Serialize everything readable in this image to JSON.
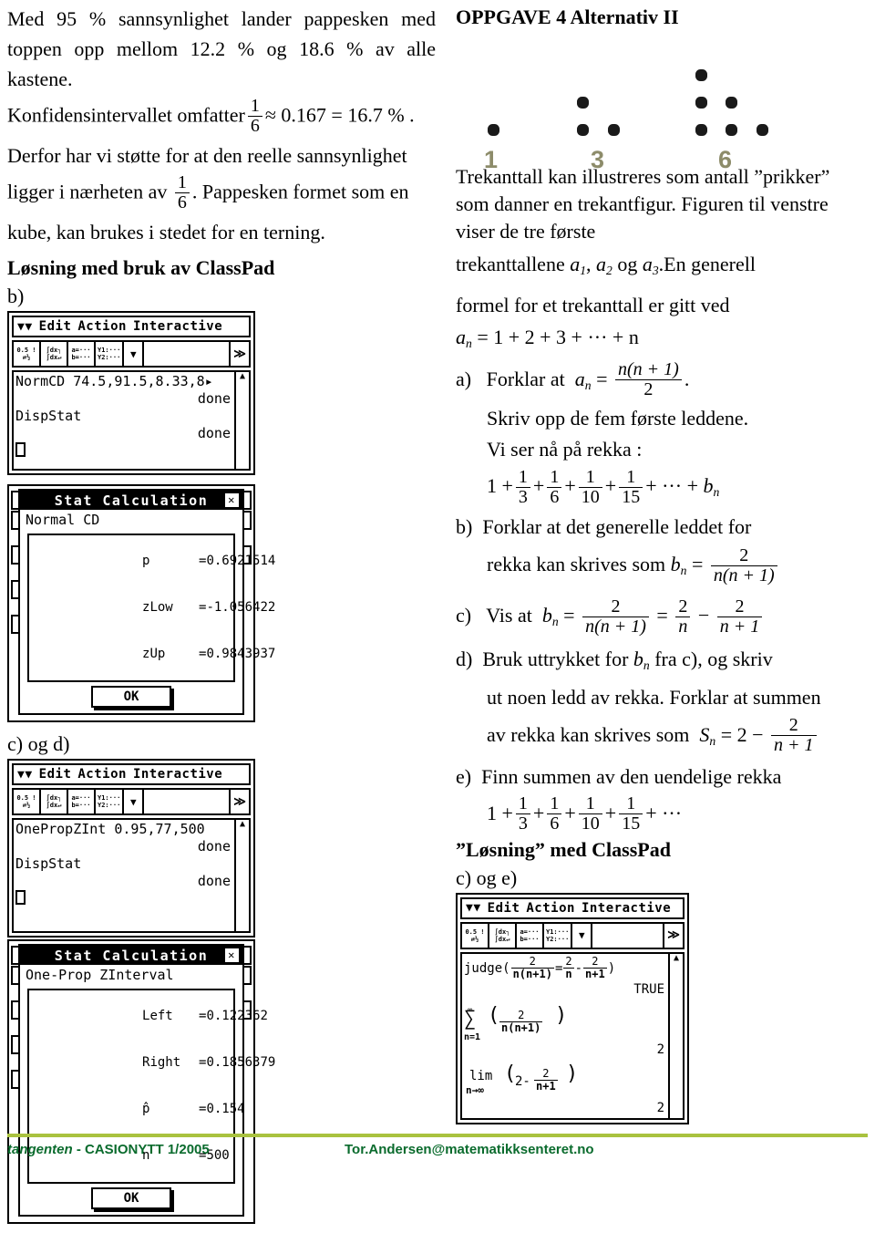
{
  "left_column": {
    "para1": "Med 95 % sannsynlighet lander pappesken med toppen opp mellom 12.2 % og 18.6 % av alle kastene.",
    "para2_pre": "Konfidensintervallet omfatter",
    "para2_frac_num": "1",
    "para2_frac_den": "6",
    "para2_post": "≈ 0.167 = 16.7 % .",
    "para3": "Derfor har vi støtte for at den reelle sannsynlighet",
    "para4_pre": "ligger i nærheten av",
    "para4_frac_num": "1",
    "para4_frac_den": "6",
    "para4_post": ". Pappesken formet som en",
    "para5": "kube, kan brukes i stedet for en terning.",
    "heading": "Løsning med bruk av ClassPad",
    "label_b": "b)",
    "label_cd": "c) og d)"
  },
  "classpad_common": {
    "menu_items": [
      "Edit",
      "Action",
      "Interactive"
    ],
    "toolbar_buttons": [
      {
        "top": "0.5 !",
        "bottom": "⇄½"
      },
      {
        "top": "∫dx┐",
        "bottom": "∫dx↵"
      },
      {
        "top": "a=···",
        "bottom": "b=···"
      },
      {
        "top": "Y1:···",
        "bottom": "Y2:···"
      }
    ],
    "dropdown_glyph": "▼",
    "expand_glyph": "≫",
    "scroll_up_glyph": "▲",
    "scroll_down_glyph": "▼",
    "done_text": "done",
    "dispstat_text": "DispStat",
    "dialog_title": "Stat Calculation",
    "close_glyph": "✕",
    "ok_label": "OK"
  },
  "classpad_b": {
    "command_line": "NormCD 74.5,91.5,8.33,8▸",
    "dialog_subtitle": "Normal CD",
    "results": [
      {
        "name": "p",
        "value": "=0.6921514"
      },
      {
        "name": "zLow",
        "value": "=-1.056422"
      },
      {
        "name": "zUp",
        "value": "=0.9843937"
      }
    ]
  },
  "classpad_cd": {
    "command_line": "OnePropZInt 0.95,77,500",
    "dialog_subtitle": "One-Prop ZInterval",
    "results": [
      {
        "name": "Left",
        "value": "=0.122362"
      },
      {
        "name": "Right",
        "value": "=0.1856379"
      },
      {
        "name": "p̂",
        "value": "=0.154"
      },
      {
        "name": "n",
        "value": "=500"
      }
    ]
  },
  "right_column": {
    "title": "OPPGAVE 4  Alternativ II",
    "figure": {
      "caption_values": [
        "1",
        "3",
        "6"
      ],
      "groups": [
        {
          "label": "1",
          "rows": [
            1
          ]
        },
        {
          "label": "3",
          "rows": [
            1,
            2
          ]
        },
        {
          "label": "6",
          "rows": [
            1,
            2,
            3
          ]
        }
      ]
    },
    "para1": "Trekanttall kan illustreres som antall ”prikker” som danner en trekantfigur. Figuren til venstre viser de tre første",
    "para2_pre": "trekanttallene",
    "para2_a1": "a",
    "para2_sub1": "1",
    "para2_a2": "a",
    "para2_sub2": "2",
    "para2_og": "og",
    "para2_a3": "a",
    "para2_sub3": "3",
    "para2_post": ".En generell",
    "para3": "formel for et trekanttall er gitt ved",
    "formula_an": "= 1 + 2 + 3 + ··· + n",
    "item_a": {
      "marker": "a)",
      "text": "Forklar at",
      "lhs": "a",
      "sub": "n",
      "eq": "=",
      "frac_num": "n(n + 1)",
      "frac_den": "2",
      "trail": ".",
      "line2": "Skriv opp de fem første leddene.",
      "line3": "Vi ser nå på rekka :"
    },
    "series1": {
      "lead": "1 +",
      "terms": [
        "3",
        "6",
        "10",
        "15"
      ],
      "numerator": "1",
      "tail": "+ ··· +",
      "tail_var": "b",
      "tail_sub": "n"
    },
    "item_b": {
      "marker": "b)",
      "line1": "Forklar at det generelle leddet for",
      "line2": "rekka kan skrives som",
      "lhs": "b",
      "sub": "n",
      "eq": "=",
      "frac_num": "2",
      "frac_den": "n(n + 1)"
    },
    "item_c": {
      "marker": "c)",
      "text": "Vis at",
      "lhs": "b",
      "sub": "n",
      "eq1": "=",
      "frac1_num": "2",
      "frac1_den": "n(n + 1)",
      "eq2": "=",
      "frac2_num": "2",
      "frac2_den": "n",
      "minus": "−",
      "frac3_num": "2",
      "frac3_den": "n + 1"
    },
    "item_d": {
      "marker": "d)",
      "line1_pre": "Bruk uttrykket for",
      "line1_var": "b",
      "line1_sub": "n",
      "line1_post": "fra c), og skriv",
      "line2": "ut noen ledd av rekka. Forklar at summen",
      "line3_pre": "av rekka kan skrives som",
      "lhs": "S",
      "sub": "n",
      "eq": "= 2 −",
      "frac_num": "2",
      "frac_den": "n + 1"
    },
    "item_e": {
      "marker": "e)",
      "line1": "Finn summen av den uendelige rekka",
      "series_lead": "1 +",
      "series_num": "1",
      "series_terms": [
        "3",
        "6",
        "10",
        "15"
      ],
      "series_tail": "+ ···"
    },
    "heading2": "”Løsning” med ClassPad",
    "label_ce": "c) og e)"
  },
  "classpad_ce": {
    "judge_label": "judge(",
    "judge_f1_num": "2",
    "judge_f1_den": "n(n+1)",
    "judge_eq": "=",
    "judge_f2_num": "2",
    "judge_f2_den": "n",
    "judge_minus": "-",
    "judge_f3_num": "2",
    "judge_f3_den": "n+1",
    "judge_close": ")",
    "judge_result": "TRUE",
    "sum_glyph": "∑",
    "sum_upper": "∞",
    "sum_lower": "n=1",
    "sum_f_num": "2",
    "sum_f_den": "n(n+1)",
    "sum_result": "2",
    "lim_label": "lim",
    "lim_sub": "n→∞",
    "lim_expr_lead": "2-",
    "lim_f_num": "2",
    "lim_f_den": "n+1",
    "lim_result": "2"
  },
  "footer": {
    "journal": "tangenten",
    "issue": "- CASIONYTT 1/2005",
    "email": "Tor.Andersen@matematikksenteret.no",
    "rule_color": "#a9c23f",
    "text_color": "#0a6b2d"
  }
}
